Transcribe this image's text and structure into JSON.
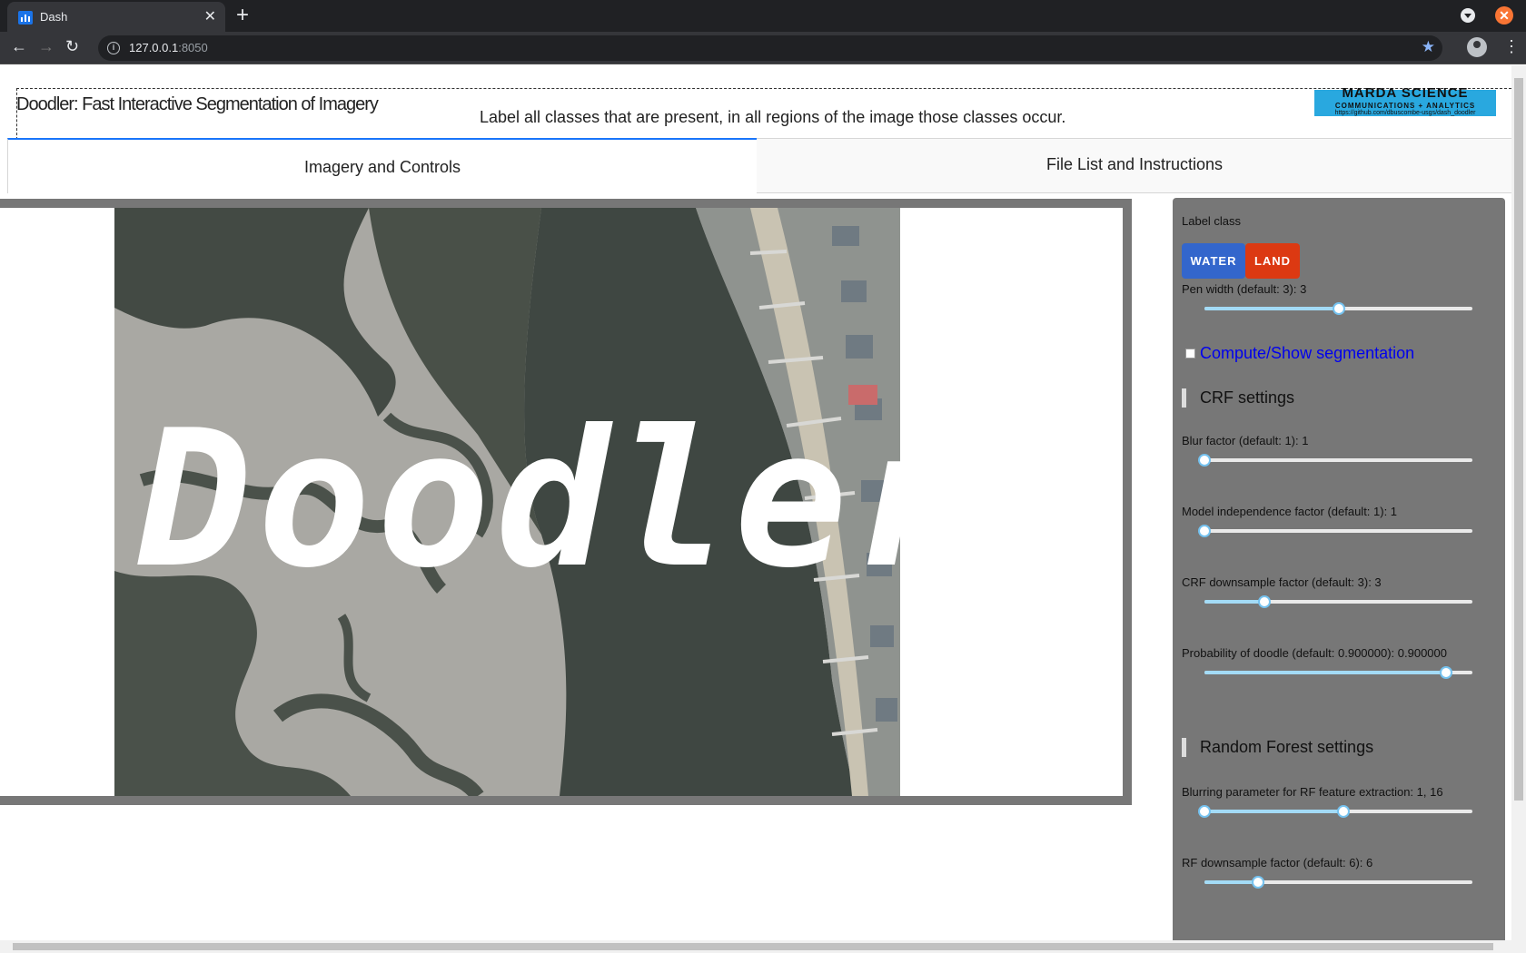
{
  "browser": {
    "tab_title": "Dash",
    "url_host": "127.0.0.1",
    "url_port": ":8050"
  },
  "app": {
    "title": "Doodler: Fast Interactive Segmentation of Imagery",
    "instruction": "Label all classes that are present, in all regions of the image those classes occur.",
    "logo": {
      "line1": "MARDA SCIENCE",
      "line2": "COMMUNICATIONS + ANALYTICS",
      "line3": "https://github.com/dbuscombe-usgs/dash_doodler"
    },
    "tabs": [
      "Imagery and Controls",
      "File List and Instructions"
    ],
    "imagery_overlay_text": "Doodler"
  },
  "controls": {
    "label_class_heading": "Label class",
    "classes": [
      {
        "label": "WATER",
        "color": "#3366cc",
        "text_color": "#ffffff"
      },
      {
        "label": "LAND",
        "color": "#dc3912",
        "text_color": "#ffffff"
      }
    ],
    "pen_width": {
      "label": "Pen width (default: 3): 3",
      "value": 3,
      "min": 1,
      "max": 5
    },
    "segmentation_checkbox": {
      "label": "Compute/Show segmentation",
      "checked": false
    },
    "crf_heading": "CRF settings",
    "blur": {
      "label": "Blur factor (default: 1): 1",
      "value": 1,
      "min": 1,
      "max": 100
    },
    "model_independence": {
      "label": "Model independence factor (default: 1): 1",
      "value": 1,
      "min": 1,
      "max": 100
    },
    "crf_downsample": {
      "label": "CRF downsample factor (default: 3): 3",
      "value": 3,
      "min": 1,
      "max": 10
    },
    "probability": {
      "label": "Probability of doodle (default: 0.900000): 0.900000",
      "value": 0.9,
      "min": 0,
      "max": 1
    },
    "rf_heading": "Random Forest settings",
    "rf_blur": {
      "label": "Blurring parameter for RF feature extraction: 1, 16",
      "range": [
        1,
        16
      ],
      "min": 1,
      "max": 30
    },
    "rf_downsample": {
      "label": "RF downsample factor (default: 6): 6",
      "value": 6,
      "min": 2,
      "max": 22
    }
  },
  "colors": {
    "tab_accent": "#1975fa",
    "panel_bg": "#777777",
    "slider_track": "#a3dbf6",
    "slider_handle_border": "#75c2ef",
    "link": "#0000ee"
  }
}
